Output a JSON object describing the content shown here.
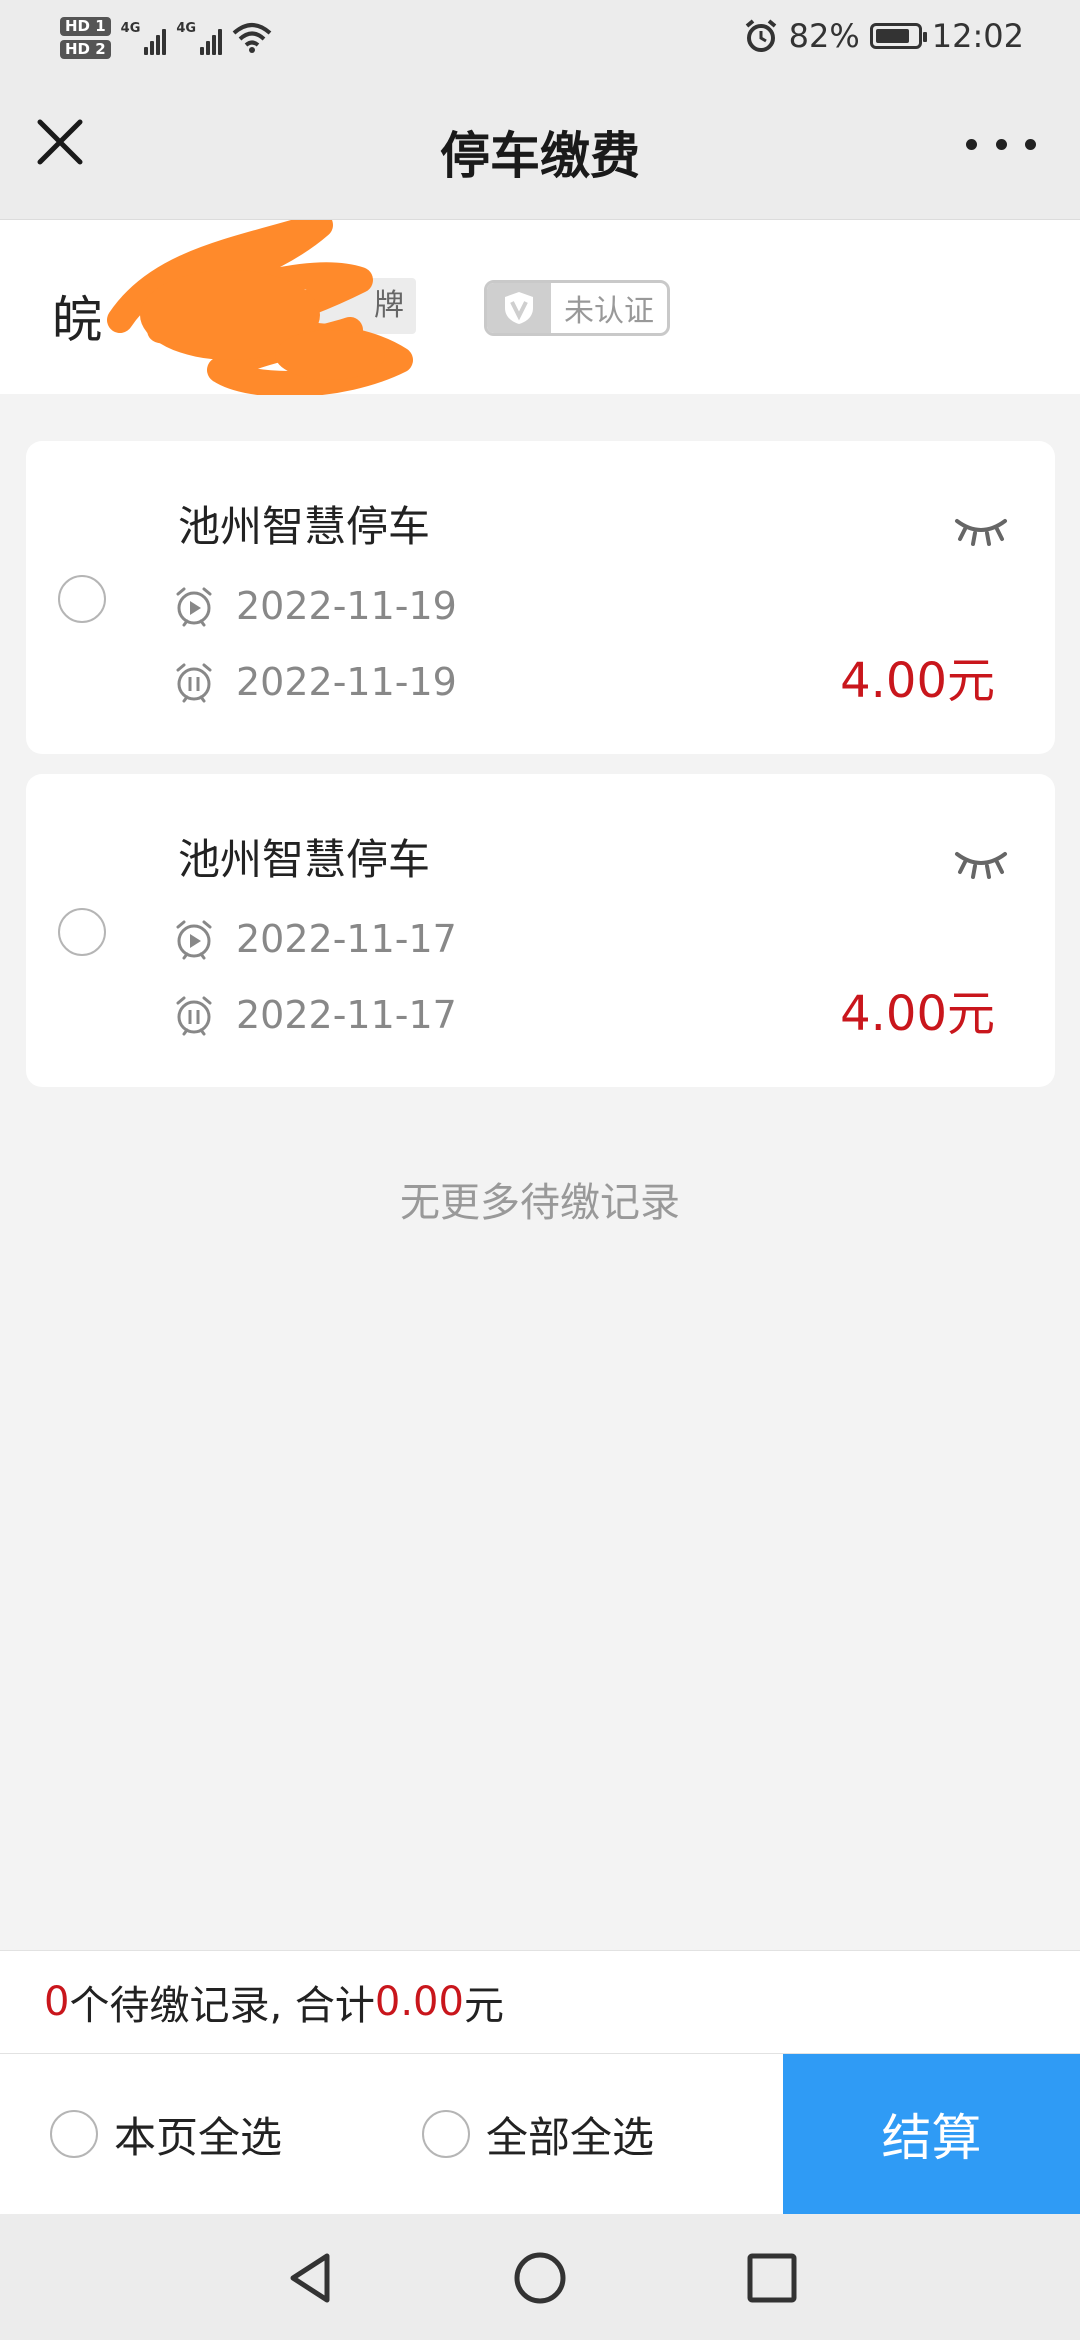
{
  "status_bar": {
    "sim1": "HD 1",
    "sim2": "HD 2",
    "network1": "4G",
    "network2": "4G",
    "battery_percent": "82%",
    "battery_level": 0.82,
    "time": "12:02",
    "icons": [
      "signal-icon",
      "wifi-icon",
      "alarm-icon",
      "battery-icon"
    ]
  },
  "nav": {
    "title": "停车缴费",
    "close_icon": "close-icon",
    "more_icon": "more-icon"
  },
  "plate": {
    "text": "皖",
    "tag": "牌",
    "cert_label": "未认证",
    "cert_icon": "shield-v-icon"
  },
  "records": [
    {
      "title": "池州智慧停车",
      "start_date": "2022-11-19",
      "end_date": "2022-11-19",
      "amount": "4.00元"
    },
    {
      "title": "池州智慧停车",
      "start_date": "2022-11-17",
      "end_date": "2022-11-17",
      "amount": "4.00元"
    }
  ],
  "no_more_text": "无更多待缴记录",
  "summary": {
    "count": "0",
    "count_suffix": "个待缴记录, 合计",
    "total": "0.00",
    "currency": "元"
  },
  "actions": {
    "select_page": "本页全选",
    "select_all": "全部全选",
    "checkout": "结算"
  },
  "colors": {
    "accent_blue": "#2f9bf5",
    "amount_red": "#c9161c",
    "redaction_orange": "#ff8a2b"
  }
}
